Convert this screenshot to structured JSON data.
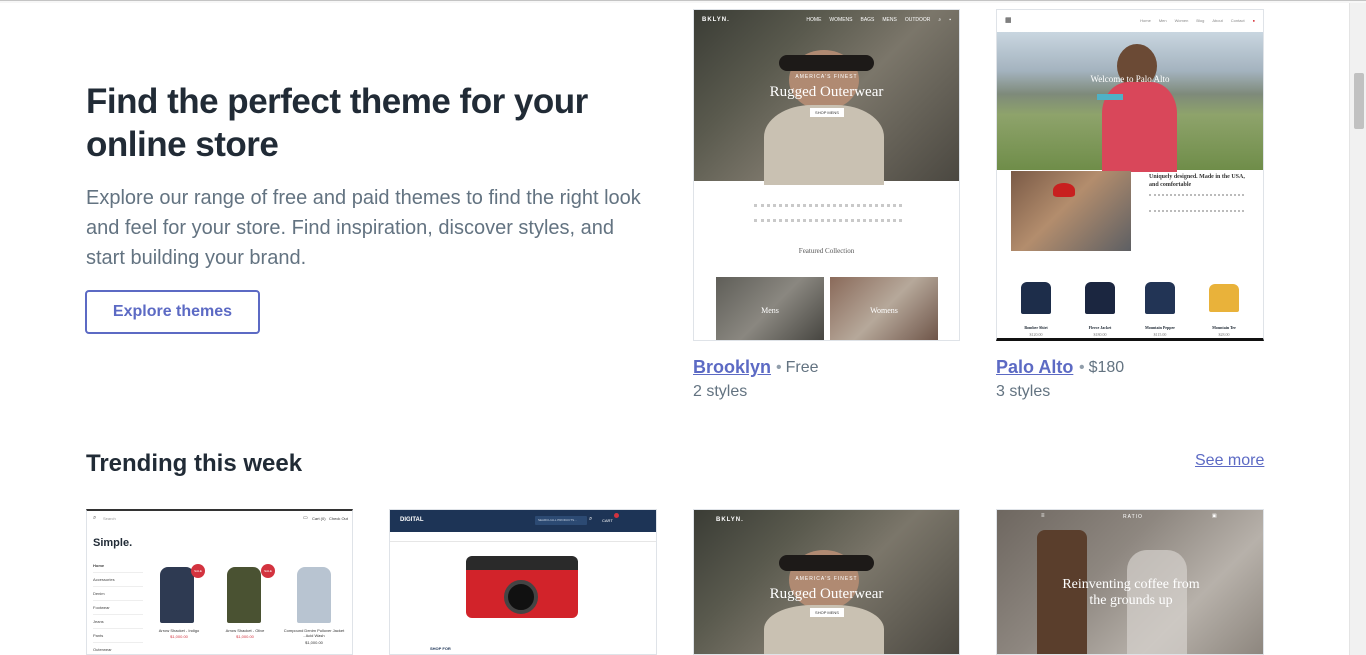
{
  "hero": {
    "title": "Find the perfect theme for your online store",
    "description": "Explore our range of free and paid themes to find the right look and feel for your store. Find inspiration, discover styles, and start building your brand.",
    "button_label": "Explore themes"
  },
  "featured": [
    {
      "name": "Brooklyn",
      "price": "Free",
      "styles": "2 styles",
      "preview": {
        "logo": "BKLYN.",
        "nav": [
          "HOME",
          "WOMENS",
          "BAGS",
          "MENS",
          "OUTDOOR"
        ],
        "kicker": "AMERICA'S FINEST",
        "headline": "Rugged Outerwear",
        "cta": "SHOP MENS",
        "section": "Featured Collection",
        "collections": [
          "Mens",
          "Womens"
        ]
      }
    },
    {
      "name": "Palo Alto",
      "price": "$180",
      "styles": "3 styles",
      "preview": {
        "nav": [
          "Home",
          "Men",
          "Women",
          "Blog",
          "About",
          "Contact"
        ],
        "headline": "Welcome to Palo Alto",
        "about_title": "Uniquely designed. Made in the USA, and comfortable",
        "products": [
          {
            "name": "Bomber Shirt",
            "price": "$120.00"
          },
          {
            "name": "Fleece Jacket",
            "price": "$180.00"
          },
          {
            "name": "Mountain Pepper",
            "price": "$115.00"
          },
          {
            "name": "Mountain Tee",
            "price": "$28.00"
          }
        ]
      }
    }
  ],
  "trending": {
    "title": "Trending this week",
    "see_more": "See more",
    "items": [
      {
        "logo": "Simple.",
        "search": "Search",
        "cart": "Cart (0)",
        "checkout": "Check Out",
        "menu": [
          "Home",
          "Accessories",
          "Denim",
          "Footwear",
          "Jeans",
          "Pants",
          "Outerwear"
        ],
        "products": [
          {
            "name": "Arrow Shacket - Indigo",
            "price": "$1,000.00",
            "badge": "SALE"
          },
          {
            "name": "Arrow Shacket - Olive",
            "price": "$1,000.00",
            "badge": "SALE"
          },
          {
            "name": "Compound Denim Pullover Jacket - Acid Wash",
            "price": "$1,000.00"
          }
        ]
      },
      {
        "logo": "DIGITAL",
        "search": "SEARCH ALL PRODUCTS...",
        "cart": "CART",
        "section": "SHOP FOR"
      },
      {
        "logo": "BKLYN.",
        "kicker": "AMERICA'S FINEST",
        "headline": "Rugged Outerwear",
        "cta": "SHOP MENS"
      },
      {
        "logo": "RATIO",
        "headline": "Reinventing coffee from the grounds up"
      }
    ]
  },
  "colors": {
    "accent": "#5c6ac4",
    "heading": "#212b36",
    "body_text": "#637381",
    "digital_nav": "#1d3456",
    "camera_red": "#d2232a"
  }
}
